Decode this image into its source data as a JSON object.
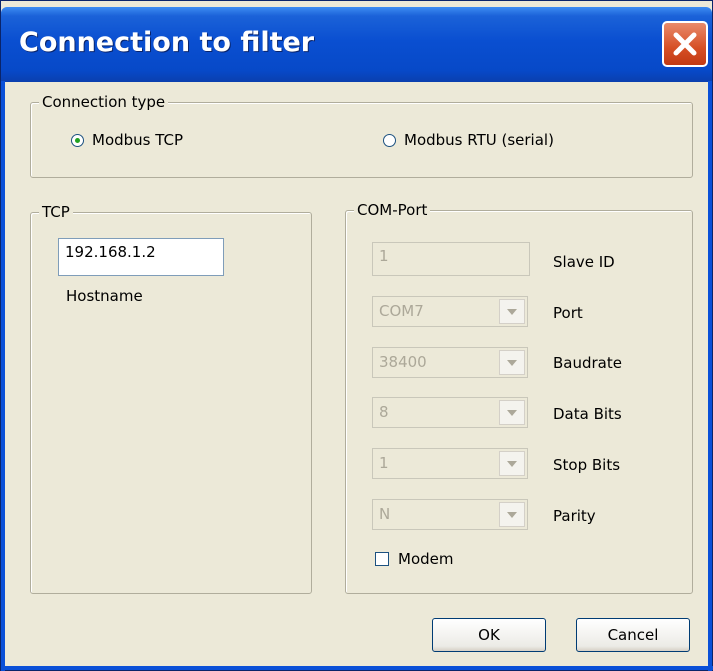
{
  "window": {
    "title": "Connection to filter"
  },
  "connection_type": {
    "legend": "Connection type",
    "options": [
      {
        "label": "Modbus TCP",
        "selected": true
      },
      {
        "label": "Modbus RTU (serial)",
        "selected": false
      }
    ]
  },
  "tcp": {
    "legend": "TCP",
    "hostname_value": "192.168.1.2",
    "hostname_label": "Hostname"
  },
  "com_port": {
    "legend": "COM-Port",
    "slave_id": {
      "value": "1",
      "label": "Slave ID"
    },
    "port": {
      "value": "COM7",
      "label": "Port"
    },
    "baudrate": {
      "value": "38400",
      "label": "Baudrate"
    },
    "data_bits": {
      "value": "8",
      "label": "Data Bits"
    },
    "stop_bits": {
      "value": "1",
      "label": "Stop Bits"
    },
    "parity": {
      "value": "N",
      "label": "Parity"
    },
    "modem": {
      "label": "Modem",
      "checked": false
    }
  },
  "buttons": {
    "ok": "OK",
    "cancel": "Cancel"
  },
  "icons": {
    "close": "close-icon",
    "dropdown": "chevron-down-icon"
  },
  "colors": {
    "titlebar": "#0a4fd1",
    "close_button": "#d64f24",
    "window_bg": "#ece9d8"
  }
}
